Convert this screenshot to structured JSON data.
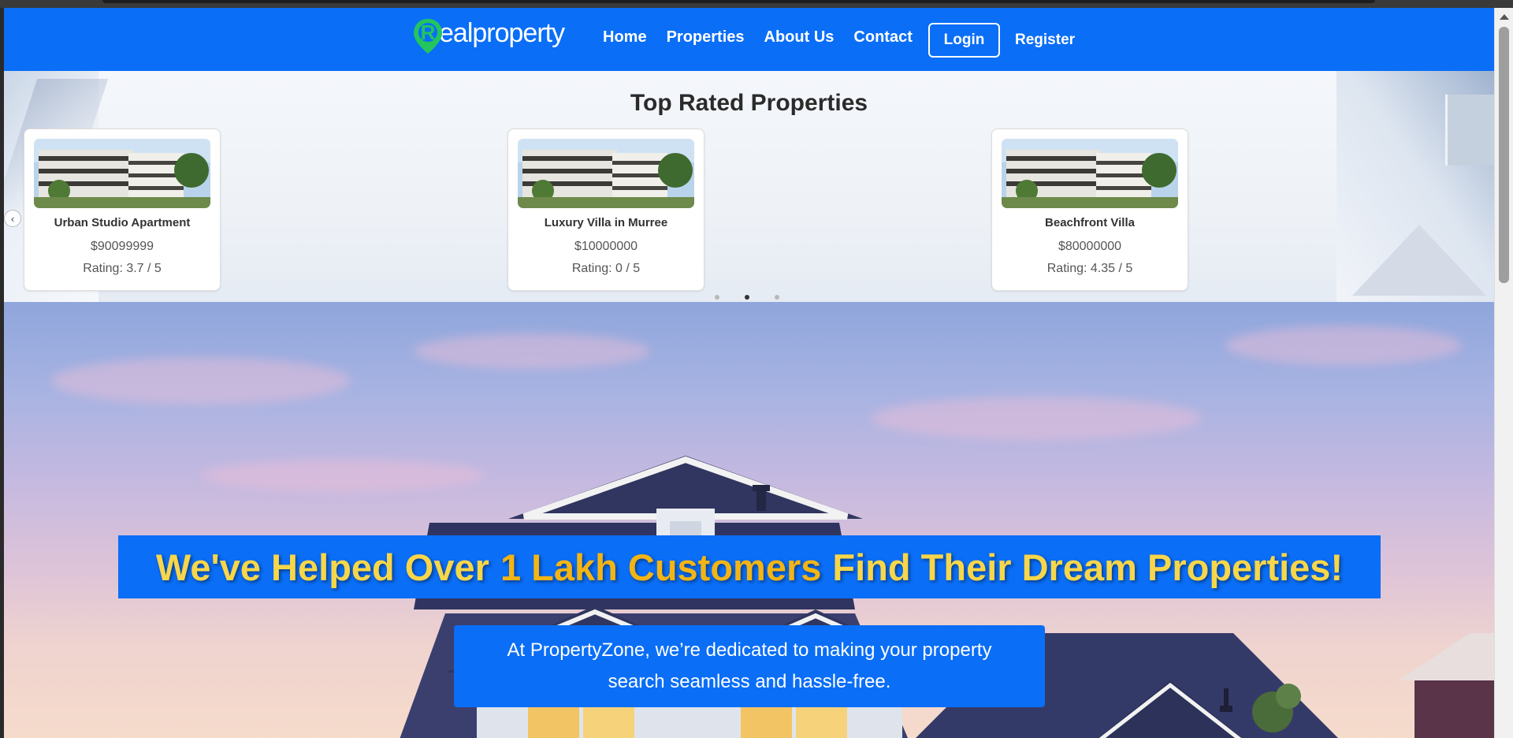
{
  "brand": {
    "logo_letter": "R",
    "logo_text": "ealproperty"
  },
  "nav": {
    "links": [
      "Home",
      "Properties",
      "About Us",
      "Contact"
    ],
    "login": "Login",
    "register": "Register"
  },
  "top_rated": {
    "title": "Top Rated Properties",
    "cards": [
      {
        "name": "Urban Studio Apartment",
        "price": "$90099999",
        "rating": "Rating: 3.7 / 5"
      },
      {
        "name": "Luxury Villa in Murree",
        "price": "$10000000",
        "rating": "Rating: 0 / 5"
      },
      {
        "name": "Beachfront Villa",
        "price": "$80000000",
        "rating": "Rating: 4.35 / 5"
      }
    ],
    "active_slide": 2,
    "slide_count": 3
  },
  "hero": {
    "headline_start": "We've Helped Over",
    "headline_accent": "1 Lakh Customers",
    "headline_end": "Find Their Dream Properties!",
    "sub_line1": "At PropertyZone, we’re dedicated to making your property",
    "sub_line2": "search seamless and hassle-free."
  },
  "colors": {
    "primary": "#0a6ef7",
    "headline": "#f7d64a",
    "accent": "#f3b415",
    "logo_green": "#22c55e"
  }
}
